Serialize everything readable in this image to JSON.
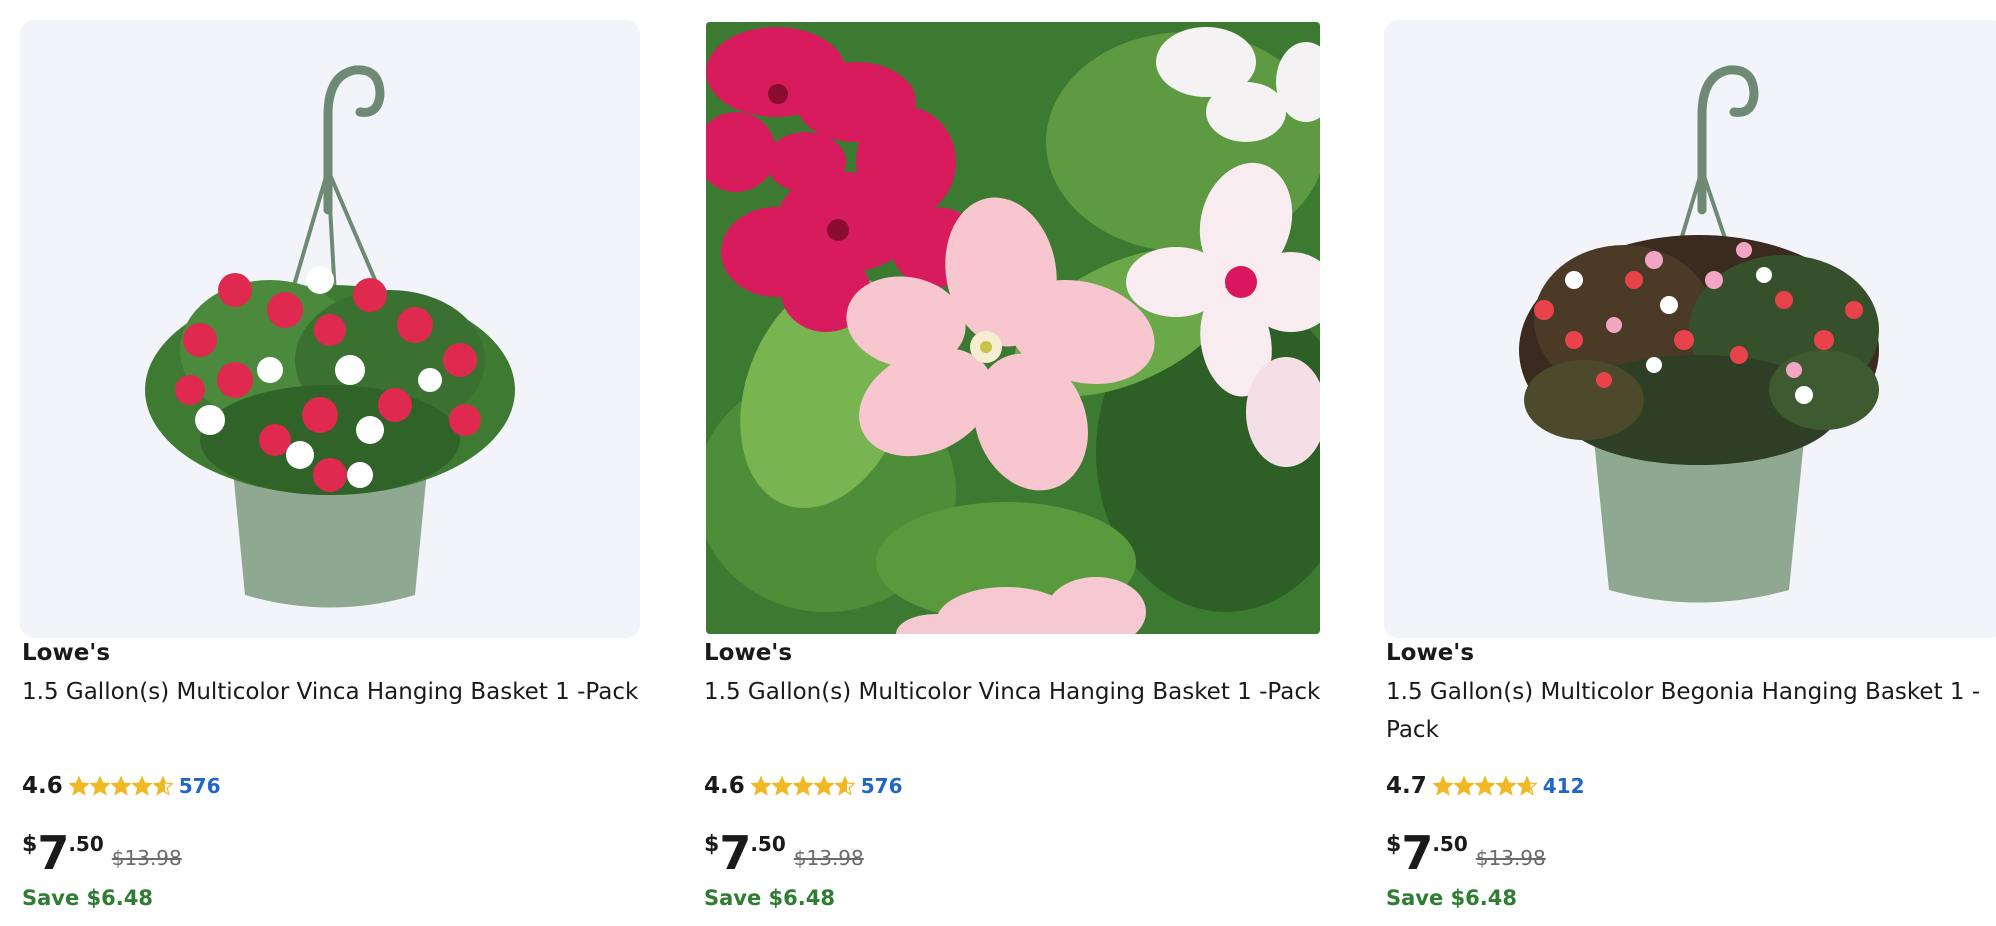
{
  "products": [
    {
      "brand": "Lowe's",
      "title": "1.5 Gallon(s) Multicolor Vinca Hanging Basket 1 -Pack",
      "rating": "4.6",
      "rating_value": 4.6,
      "review_count": "576",
      "price": {
        "currency": "$",
        "dollars": "7",
        "cents": ".50"
      },
      "was_price": "$13.98",
      "savings": "Save $6.48",
      "image": "vinca-hanging-basket"
    },
    {
      "brand": "Lowe's",
      "title": "1.5 Gallon(s) Multicolor Vinca Hanging Basket 1 -Pack",
      "rating": "4.6",
      "rating_value": 4.6,
      "review_count": "576",
      "price": {
        "currency": "$",
        "dollars": "7",
        "cents": ".50"
      },
      "was_price": "$13.98",
      "savings": "Save $6.48",
      "image": "vinca-flowers-closeup"
    },
    {
      "brand": "Lowe's",
      "title": "1.5 Gallon(s) Multicolor Begonia Hanging Basket 1 -Pack",
      "rating": "4.7",
      "rating_value": 4.7,
      "review_count": "412",
      "price": {
        "currency": "$",
        "dollars": "7",
        "cents": ".50"
      },
      "was_price": "$13.98",
      "savings": "Save $6.48",
      "image": "begonia-hanging-basket"
    }
  ],
  "colors": {
    "star": "#f0b823",
    "review_link": "#1f66c8",
    "savings": "#2e7d32",
    "pot": "#8fa892"
  }
}
